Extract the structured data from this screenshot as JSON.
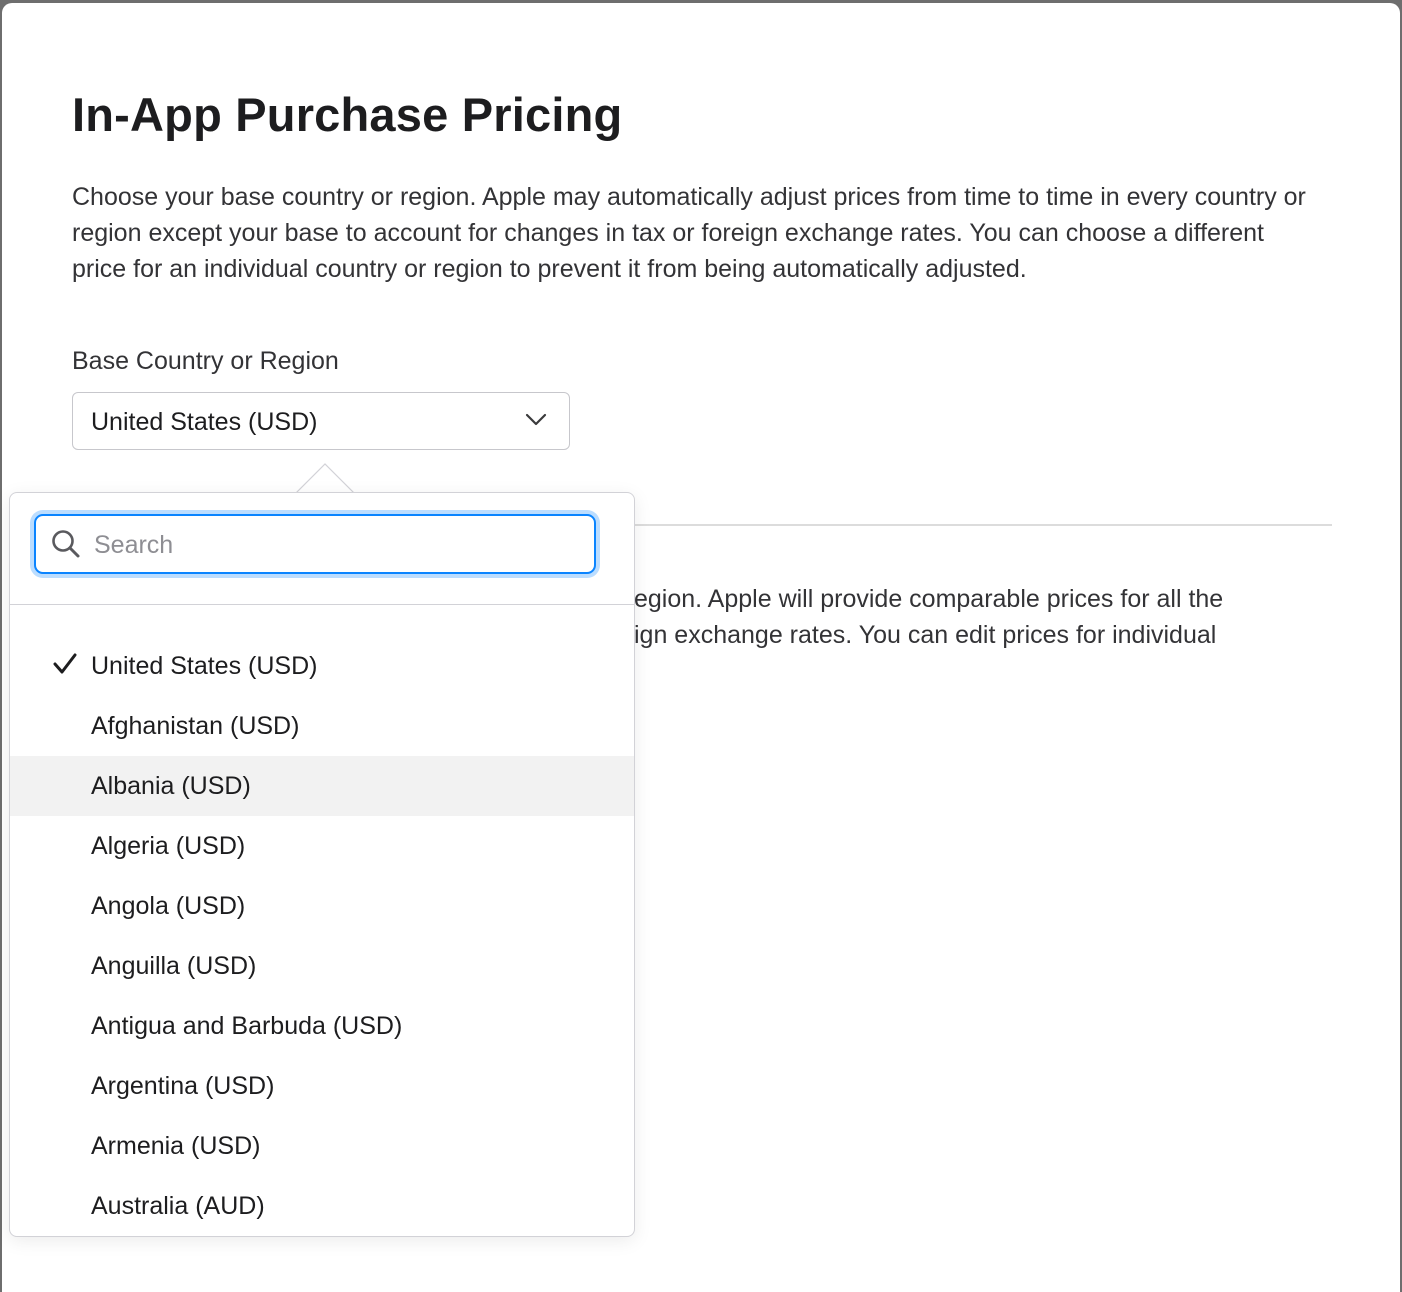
{
  "dialog": {
    "title": "In-App Purchase Pricing",
    "intro": "Choose your base country or region. Apple may automatically adjust prices from time to time in every country or region except your base to account for changes in tax or foreign exchange rates. You can choose a different price for an individual country or region to prevent it from being automatically adjusted.",
    "base_label": "Base Country or Region",
    "base_value": "United States (USD)",
    "lower_text_line1": "egion. Apple will provide comparable prices for all the",
    "lower_text_line2": "ign exchange rates. You can edit prices for individual"
  },
  "dropdown": {
    "search_placeholder": "Search",
    "options": [
      {
        "label": "United States (USD)",
        "selected": true
      },
      {
        "label": "Afghanistan (USD)"
      },
      {
        "label": "Albania (USD)",
        "hovered": true
      },
      {
        "label": "Algeria (USD)"
      },
      {
        "label": "Angola (USD)"
      },
      {
        "label": "Anguilla (USD)"
      },
      {
        "label": "Antigua and Barbuda (USD)"
      },
      {
        "label": "Argentina (USD)"
      },
      {
        "label": "Armenia (USD)"
      },
      {
        "label": "Australia (AUD)"
      }
    ]
  },
  "icons": {
    "select": "chevron-down-icon",
    "search": "search-icon",
    "selected": "checkmark-icon"
  },
  "colors": {
    "focus_ring": "#0a84ff",
    "hover_row": "#f2f2f2",
    "text": "#1d1d1f"
  }
}
